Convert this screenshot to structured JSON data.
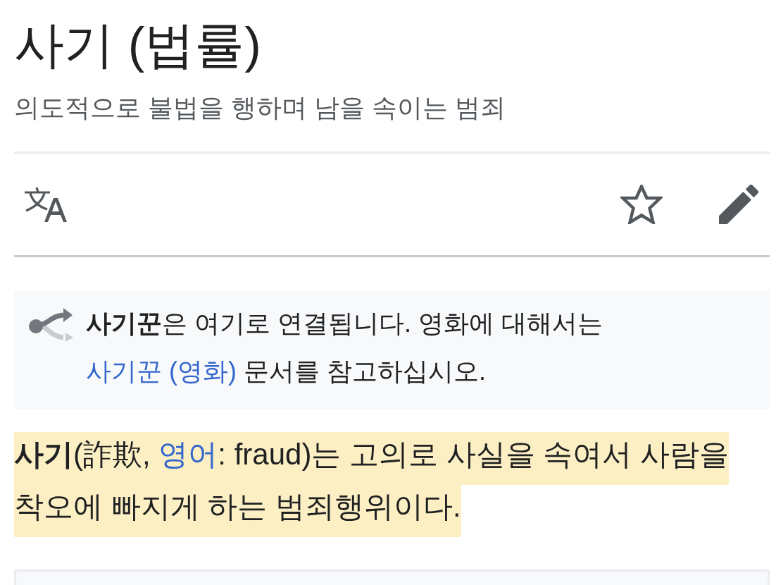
{
  "article": {
    "title": "사기 (법률)",
    "description": "의도적으로 불법을 행하며 남을 속이는 범죄"
  },
  "toolbar": {
    "starred": false
  },
  "hatnote": {
    "parts": [
      {
        "kind": "text",
        "text": "**사기꾼**은 여기로 연결됩니다. 영화에 대해서는 "
      },
      {
        "kind": "link",
        "text": "사기꾼 (영화)"
      },
      {
        "kind": "text",
        "text": " 문서를 참고하십시오."
      }
    ]
  },
  "lead": {
    "highlighted": true,
    "parts": [
      {
        "kind": "text",
        "text": "**사기**(詐欺, "
      },
      {
        "kind": "link",
        "text": "영어"
      },
      {
        "kind": "text",
        "text": ": fraud)는 고의로 사실을 속여서 사람을 착오에 빠지게 하는 범죄행위이다."
      }
    ]
  }
}
